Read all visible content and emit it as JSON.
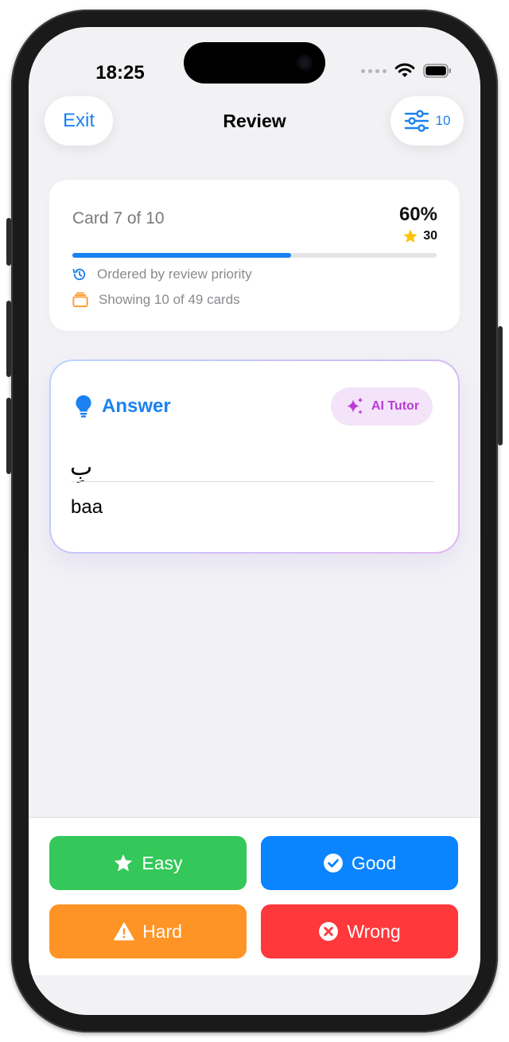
{
  "status_bar": {
    "time": "18:25"
  },
  "nav": {
    "exit_label": "Exit",
    "title": "Review",
    "filter_count": "10"
  },
  "progress": {
    "card_label": "Card 7 of 10",
    "percent_label": "60%",
    "percent_value": 60,
    "stars": "30",
    "order_label": "Ordered by review priority",
    "showing_label": "Showing 10 of 49 cards"
  },
  "answer": {
    "label": "Answer",
    "ai_tutor_label": "AI Tutor",
    "arabic": "بِ",
    "transliteration": "baa"
  },
  "grades": {
    "easy": "Easy",
    "good": "Good",
    "hard": "Hard",
    "wrong": "Wrong"
  },
  "colors": {
    "accent": "#1a82f0",
    "easy": "#34c759",
    "good": "#0a84ff",
    "hard": "#ff9426",
    "wrong": "#ff383c",
    "ai_tutor": "#b93bd6",
    "star": "#ffc40a"
  },
  "icons": {
    "filter": "sliders-icon",
    "order": "clock-history-icon",
    "showing": "stack-icon",
    "answer": "lightbulb-icon",
    "ai": "sparkles-icon",
    "easy": "star-icon",
    "good": "checkmark-circle-icon",
    "hard": "warning-triangle-icon",
    "wrong": "x-circle-icon"
  }
}
